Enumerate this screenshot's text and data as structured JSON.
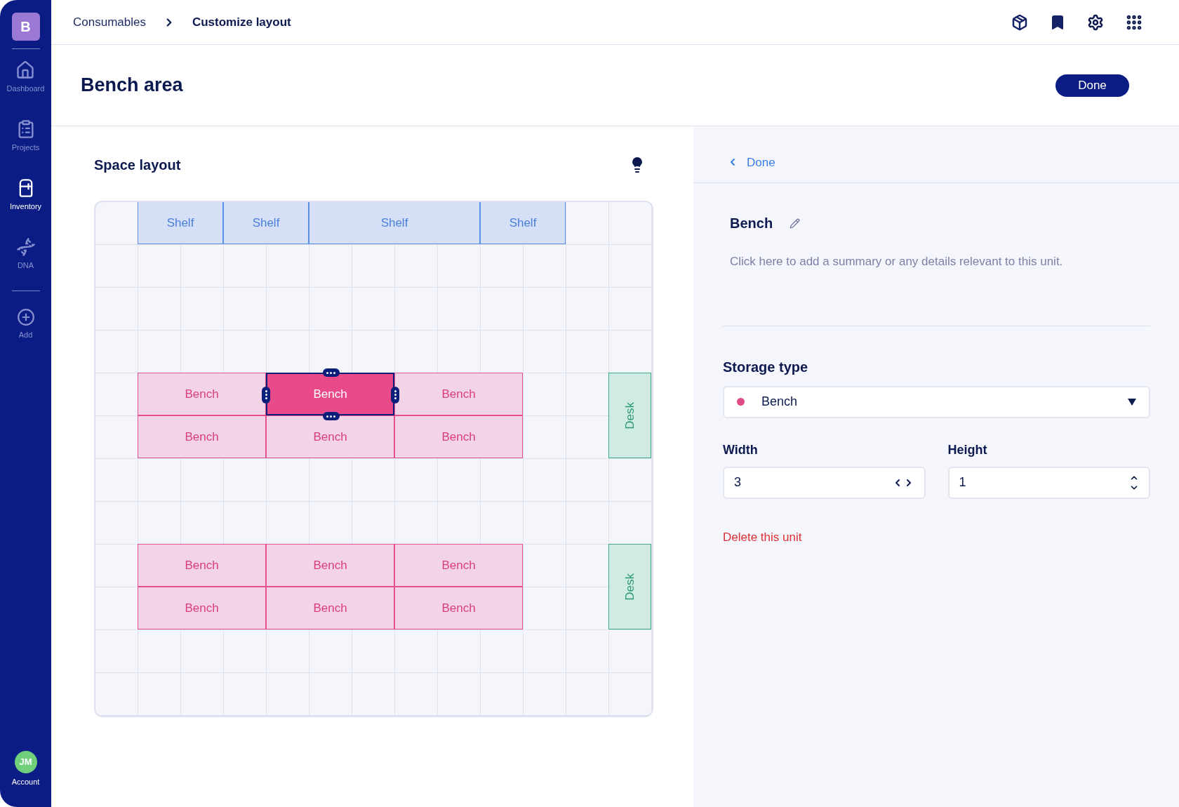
{
  "sidebar": {
    "logo": "B",
    "items": [
      {
        "label": "Dashboard",
        "selected": false
      },
      {
        "label": "Projects",
        "selected": false
      },
      {
        "label": "Inventory",
        "selected": true
      },
      {
        "label": "DNA",
        "selected": false
      }
    ],
    "add": {
      "label": "Add"
    },
    "account": {
      "initials": "JM",
      "label": "Account"
    }
  },
  "breadcrumb": [
    {
      "label": "Consumables",
      "current": false
    },
    {
      "label": "Customize layout",
      "current": true
    }
  ],
  "page": {
    "title": "Bench area",
    "done_button": "Done"
  },
  "layout": {
    "title": "Space layout",
    "units": [
      {
        "kind": "shelf",
        "label": "Shelf",
        "selected": false
      },
      {
        "kind": "shelf",
        "label": "Shelf",
        "selected": false
      },
      {
        "kind": "shelf",
        "label": "Shelf",
        "selected": false
      },
      {
        "kind": "shelf",
        "label": "Shelf",
        "selected": false
      },
      {
        "kind": "bench",
        "label": "Bench",
        "selected": false
      },
      {
        "kind": "bench",
        "label": "Bench",
        "selected": true
      },
      {
        "kind": "bench",
        "label": "Bench",
        "selected": false
      },
      {
        "kind": "desk",
        "label": "Desk",
        "selected": false
      },
      {
        "kind": "bench",
        "label": "Bench",
        "selected": false
      },
      {
        "kind": "bench",
        "label": "Bench",
        "selected": false
      },
      {
        "kind": "bench",
        "label": "Bench",
        "selected": false
      },
      {
        "kind": "bench",
        "label": "Bench",
        "selected": false
      },
      {
        "kind": "bench",
        "label": "Bench",
        "selected": false
      },
      {
        "kind": "bench",
        "label": "Bench",
        "selected": false
      },
      {
        "kind": "desk",
        "label": "Desk",
        "selected": false
      },
      {
        "kind": "bench",
        "label": "Bench",
        "selected": false
      },
      {
        "kind": "bench",
        "label": "Bench",
        "selected": false
      },
      {
        "kind": "bench",
        "label": "Bench",
        "selected": false
      }
    ]
  },
  "panel": {
    "back_link": "Done",
    "unit_name": "Bench",
    "description": "Click here to add a summary or any details relevant to this unit.",
    "storage_type": {
      "label": "Storage type",
      "value": "Bench",
      "color": "#e04a86"
    },
    "width": {
      "label": "Width",
      "value": "3"
    },
    "height": {
      "label": "Height",
      "value": "1"
    },
    "delete_link": "Delete this unit"
  }
}
